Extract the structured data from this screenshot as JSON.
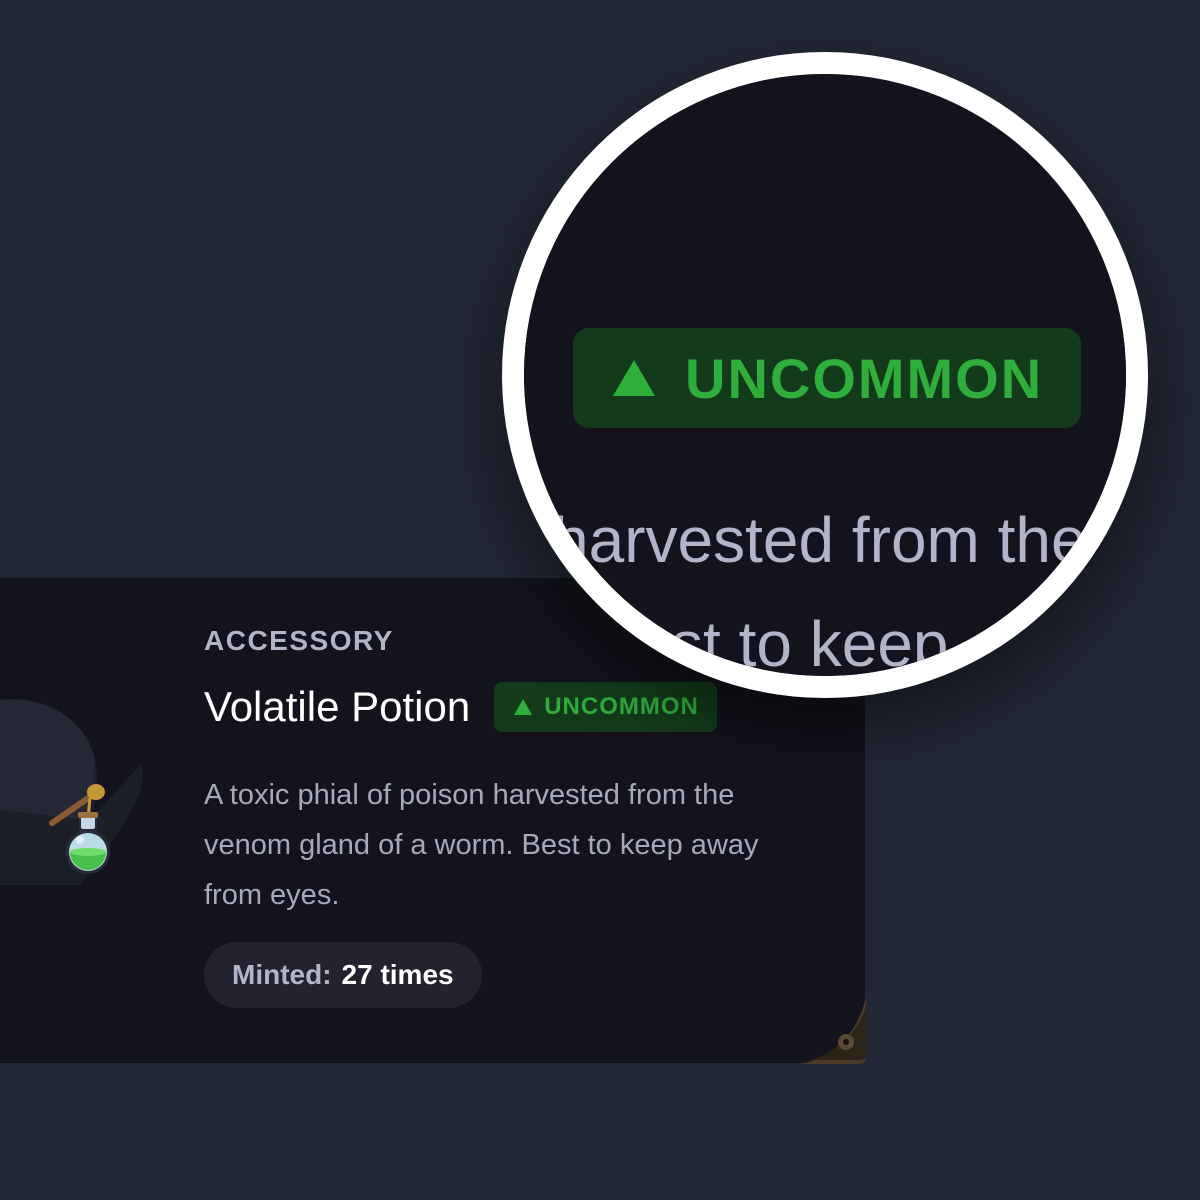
{
  "item": {
    "category": "ACCESSORY",
    "title": "Volatile Potion",
    "rarity": "UNCOMMON",
    "rarity_icon": "triangle-up-icon",
    "description": "A toxic phial of poison harvested from the venom gland of a worm. Best to keep away from eyes.",
    "minted_label": "Minted:",
    "minted_value": "27 times",
    "image": "potion-illustration"
  },
  "magnifier": {
    "rarity": "UNCOMMON",
    "text_line1": "harvested from the",
    "text_line2": "st to keep"
  },
  "colors": {
    "background": "#212734",
    "card": "#12131c",
    "rarity_green": "#2fae3c",
    "rarity_badge_bg": "#133b1b",
    "muted_text": "#a8a8bc",
    "title_text": "#ffffff"
  }
}
